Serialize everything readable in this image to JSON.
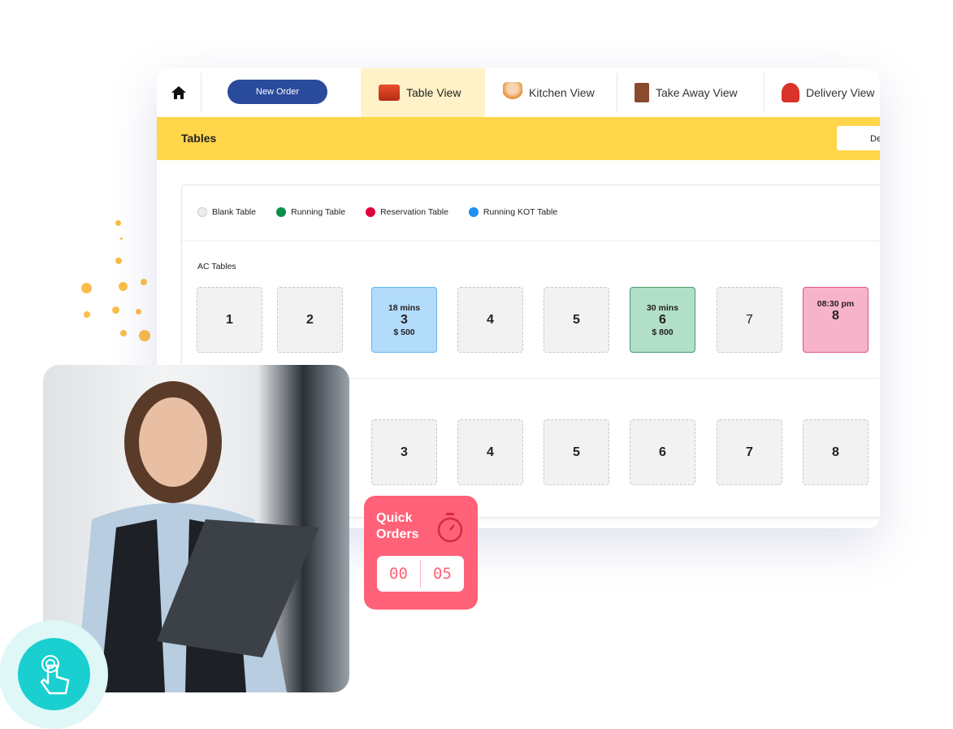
{
  "nav": {
    "new_order": "New Order",
    "tabs": [
      {
        "label": "Table View",
        "icon": "table-dining-icon"
      },
      {
        "label": "Kitchen View",
        "icon": "chef-icon"
      },
      {
        "label": "Take Away View",
        "icon": "takeaway-bag-icon"
      },
      {
        "label": "Delivery View",
        "icon": "delivery-scooter-icon"
      }
    ]
  },
  "header": {
    "title": "Tables",
    "button": "De"
  },
  "legend": [
    {
      "label": "Blank Table",
      "color": "#eeeeee"
    },
    {
      "label": "Running Table",
      "color": "#0a8f4a"
    },
    {
      "label": "Reservation Table",
      "color": "#e0003c"
    },
    {
      "label": "Running KOT Table",
      "color": "#1e90f0"
    }
  ],
  "section1": {
    "title": "AC Tables",
    "tables": [
      {
        "num": "1"
      },
      {
        "num": "2"
      },
      {
        "num": "3",
        "top": "18 mins",
        "bottom": "$ 500",
        "status": "running-kot"
      },
      {
        "num": "4"
      },
      {
        "num": "5"
      },
      {
        "num": "6",
        "top": "30 mins",
        "bottom": "$ 800",
        "status": "running"
      },
      {
        "num": "7"
      },
      {
        "num": "8",
        "top": "08:30 pm",
        "status": "reservation"
      }
    ]
  },
  "section2": {
    "tables": [
      "3",
      "4",
      "5",
      "6",
      "7",
      "8"
    ]
  },
  "quick_orders": {
    "title_line1": "Quick",
    "title_line2": "Orders",
    "min": "00",
    "sec": "05"
  },
  "colors": {
    "accent": "#ffd54a",
    "brand": "#2a4a9b",
    "quick": "#ff6178",
    "touch": "#1acfcf"
  }
}
